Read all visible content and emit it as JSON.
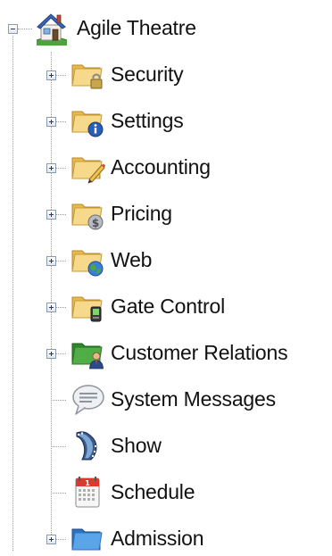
{
  "root": {
    "label": "Agile Theatre",
    "icon": "house-icon",
    "expanded": true
  },
  "items": [
    {
      "label": "Security",
      "icon": "folder-lock-icon",
      "expandable": true
    },
    {
      "label": "Settings",
      "icon": "folder-info-icon",
      "expandable": true
    },
    {
      "label": "Accounting",
      "icon": "folder-pencil-icon",
      "expandable": true
    },
    {
      "label": "Pricing",
      "icon": "folder-dollar-icon",
      "expandable": true
    },
    {
      "label": "Web",
      "icon": "folder-globe-icon",
      "expandable": true
    },
    {
      "label": "Gate Control",
      "icon": "folder-device-icon",
      "expandable": true
    },
    {
      "label": "Customer Relations",
      "icon": "folder-person-icon",
      "expandable": true
    },
    {
      "label": "System Messages",
      "icon": "speech-bubble-icon",
      "expandable": false
    },
    {
      "label": "Show",
      "icon": "film-strip-icon",
      "expandable": false
    },
    {
      "label": "Schedule",
      "icon": "calendar-icon",
      "expandable": false
    },
    {
      "label": "Admission",
      "icon": "folder-blue-icon",
      "expandable": true
    }
  ],
  "colors": {
    "folder_yellow": "#f3d27a",
    "folder_green": "#3f9b3a",
    "folder_blue": "#3f8fd8",
    "guide_line": "#9a9a9a"
  }
}
